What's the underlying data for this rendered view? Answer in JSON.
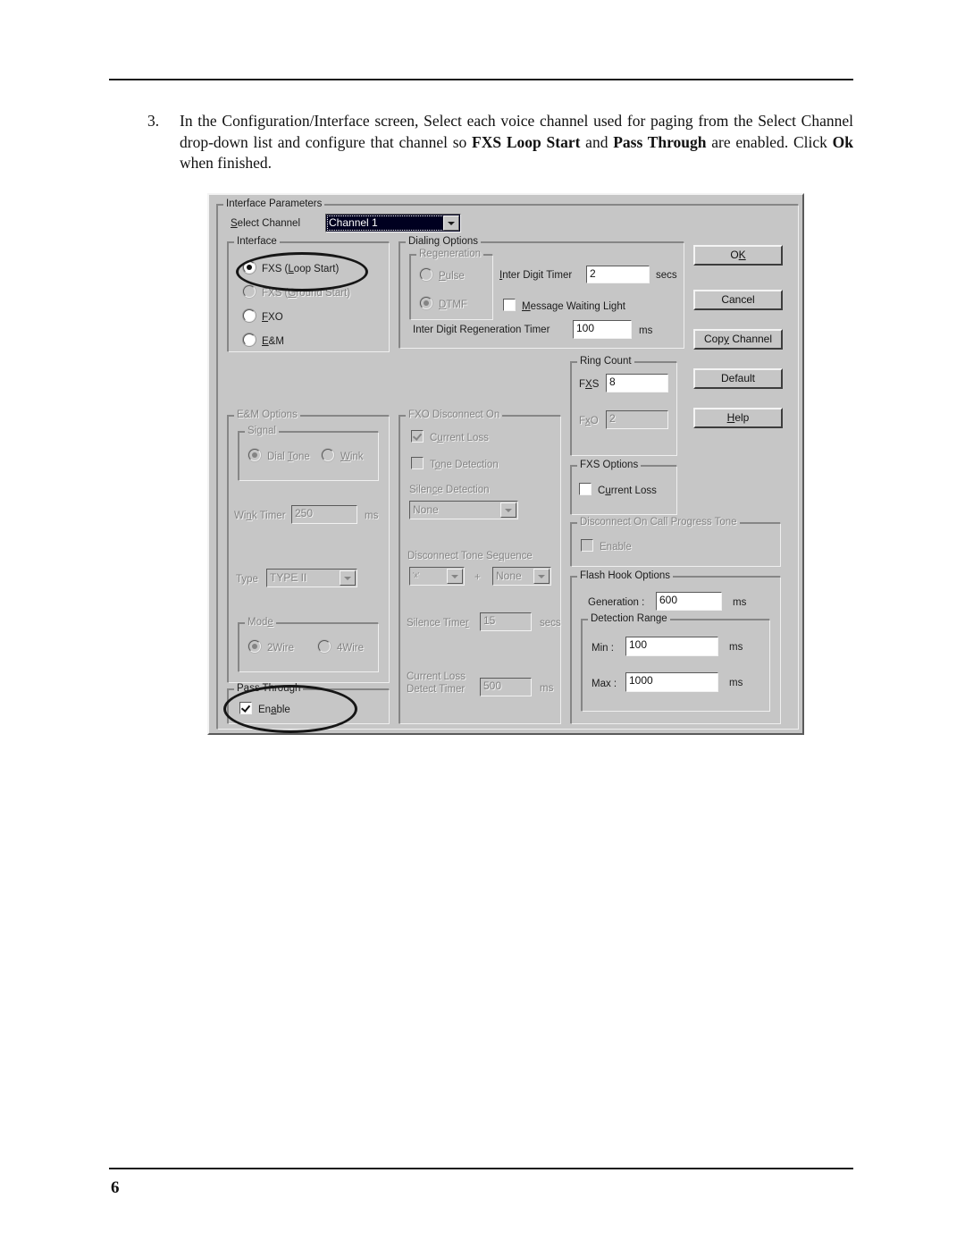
{
  "page": {
    "number": "6",
    "step_number": "3.",
    "instruction_parts": [
      {
        "t": "In the Configuration/Interface screen, Select each voice channel used for paging from the Select Channel drop-down list and configure that channel so ",
        "b": false
      },
      {
        "t": "FXS Loop Start",
        "b": true
      },
      {
        "t": " and ",
        "b": false
      },
      {
        "t": "Pass Through",
        "b": true
      },
      {
        "t": " are enabled. Click ",
        "b": false
      },
      {
        "t": "Ok",
        "b": true
      },
      {
        "t": " when finished.",
        "b": false
      }
    ]
  },
  "dialog": {
    "title": "Interface Parameters",
    "select_channel": {
      "label": "Select Channel",
      "value": "Channel 1"
    },
    "interface": {
      "title": "Interface",
      "options": [
        {
          "label": "FXS (Loop Start)",
          "selected": true,
          "disabled": false
        },
        {
          "label": "FXS (Ground Start)",
          "selected": false,
          "disabled": true
        },
        {
          "label": "FXO",
          "selected": false,
          "disabled": false
        },
        {
          "label": "E&M",
          "selected": false,
          "disabled": false
        }
      ]
    },
    "dialing_options": {
      "title": "Dialing Options",
      "regeneration": {
        "title": "Regeneration",
        "options": [
          {
            "label": "Pulse",
            "selected": false,
            "disabled": true
          },
          {
            "label": "DTMF",
            "selected": true,
            "disabled": true
          }
        ]
      },
      "inter_digit_timer": {
        "label": "Inter Digit Timer",
        "value": "2",
        "unit": "secs"
      },
      "message_waiting_light": {
        "label": "Message Waiting Light",
        "checked": false
      },
      "inter_digit_regen_timer": {
        "label": "Inter Digit Regeneration Timer",
        "value": "100",
        "unit": "ms"
      }
    },
    "em_options": {
      "title": "E&M Options",
      "signal": {
        "title": "Signal",
        "options": [
          {
            "label": "Dial Tone",
            "selected": true,
            "disabled": true
          },
          {
            "label": "Wink",
            "selected": false,
            "disabled": true
          }
        ]
      },
      "wink_timer": {
        "label": "Wink Timer",
        "value": "250",
        "unit": "ms"
      },
      "type": {
        "label": "Type",
        "value": "TYPE II"
      },
      "mode": {
        "title": "Mode",
        "options": [
          {
            "label": "2Wire",
            "selected": true,
            "disabled": true
          },
          {
            "label": "4Wire",
            "selected": false,
            "disabled": true
          }
        ]
      }
    },
    "pass_through": {
      "title": "Pass Through",
      "enable": {
        "label": "Enable",
        "checked": true
      }
    },
    "fxo_disconnect_on": {
      "title": "FXO Disconnect On",
      "current_loss": {
        "label": "Current Loss",
        "checked": true
      },
      "tone_detection": {
        "label": "Tone Detection",
        "checked": false
      },
      "silence_detection": {
        "label": "Silence Detection",
        "value": "None"
      },
      "disconnect_tone_sequence": {
        "label": "Disconnect Tone Sequence",
        "first_value": "'x'",
        "plus": "+",
        "second_value": "None"
      },
      "silence_timer": {
        "label": "Silence Timer",
        "value": "15",
        "unit": "secs"
      },
      "current_loss_detect_timer": {
        "label_line1": "Current Loss",
        "label_line2": "Detect Timer",
        "value": "500",
        "unit": "ms"
      }
    },
    "ring_count": {
      "title": "Ring Count",
      "fxs": {
        "label": "FXS",
        "value": "8"
      },
      "fxo": {
        "label": "FxO",
        "value": "2"
      }
    },
    "fxs_options": {
      "title": "FXS Options",
      "current_loss": {
        "label": "Current  Loss",
        "checked": false
      }
    },
    "disconnect_on_cpt": {
      "title": "Disconnect On Call Progress Tone",
      "enable": {
        "label": "Enable",
        "checked": false
      }
    },
    "flash_hook_options": {
      "title": "Flash Hook Options",
      "generation": {
        "label": "Generation :",
        "value": "600",
        "unit": "ms"
      },
      "detection_range": {
        "title": "Detection Range",
        "min": {
          "label": "Min :",
          "value": "100",
          "unit": "ms"
        },
        "max": {
          "label": "Max :",
          "value": "1000",
          "unit": "ms"
        }
      }
    },
    "buttons": [
      {
        "label": "OK"
      },
      {
        "label": "Cancel"
      },
      {
        "label": "Copy Channel"
      },
      {
        "label": "Default"
      },
      {
        "label": "Help"
      }
    ]
  }
}
